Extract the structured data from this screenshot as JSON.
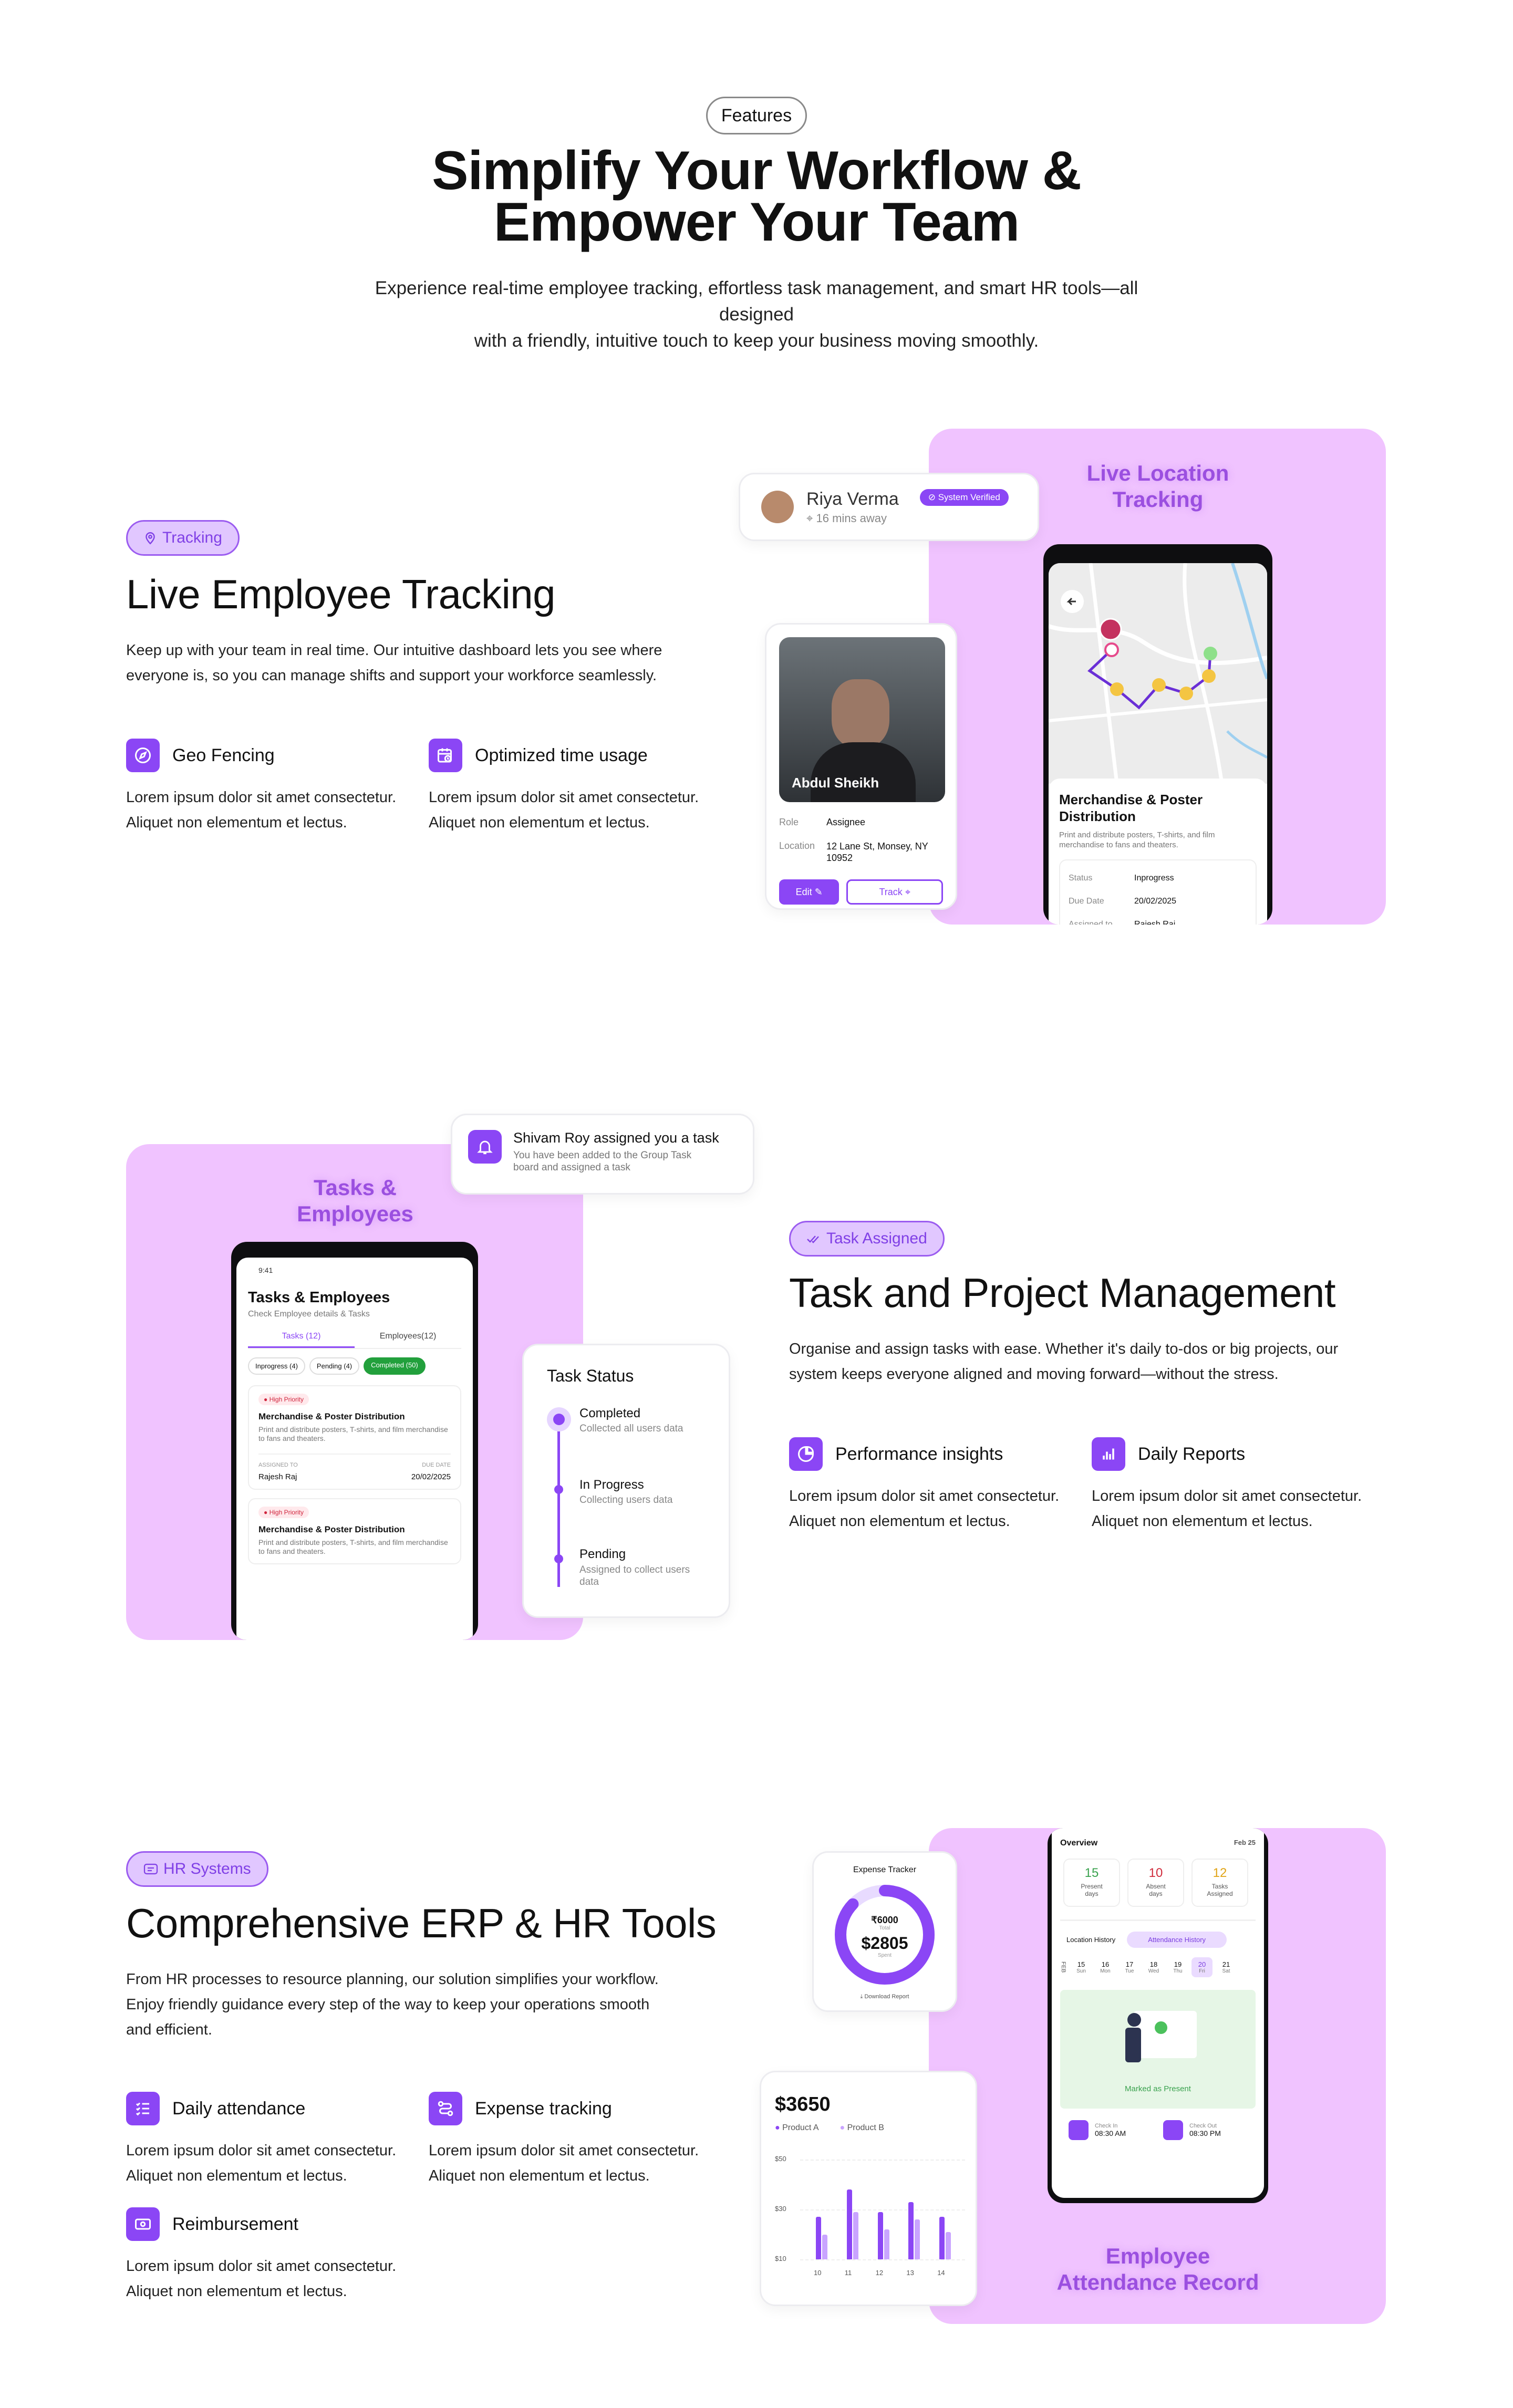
{
  "header": {
    "pill": "Features",
    "title_line1": "Simplify Your Workflow &",
    "title_line2": "Empower Your Team",
    "subtitle_line1": "Experience real-time employee tracking, effortless task management, and smart HR tools—all designed",
    "subtitle_line2": "with a friendly, intuitive touch to keep your business moving smoothly."
  },
  "tracking": {
    "tag": "Tracking",
    "title": "Live Employee Tracking",
    "desc_line1": "Keep up with your team in real time. Our intuitive dashboard lets you see where",
    "desc_line2": "everyone is, so you can manage shifts and support your workforce seamlessly.",
    "features": [
      {
        "title": "Geo Fencing",
        "line1": "Lorem ipsum dolor sit amet consectetur.",
        "line2": "Aliquet non elementum et lectus."
      },
      {
        "title": "Optimized time usage",
        "line1": "Lorem ipsum dolor sit amet consectetur.",
        "line2": "Aliquet non elementum et lectus."
      }
    ],
    "visual": {
      "label_line1": "Live Location",
      "label_line2": "Tracking",
      "user_name": "Riya Verma",
      "user_distance": "16 mins away",
      "verified": "System Verified",
      "profile_name": "Abdul Sheikh",
      "role_label": "Role",
      "role_value": "Assignee",
      "location_label": "Location",
      "location_value": "12 Lane St, Monsey, NY 10952",
      "edit": "Edit",
      "track": "Track",
      "task_title": "Merchandise & Poster Distribution",
      "task_desc": "Print and distribute posters, T-shirts, and film merchandise to fans and theaters.",
      "status_label": "Status",
      "status_value": "Inprogress",
      "due_label": "Due Date",
      "due_value": "20/02/2025",
      "assigned_label": "Assigned to",
      "assigned_value": "Rajesh Raj"
    }
  },
  "tasks": {
    "tag": "Task Assigned",
    "title": "Task and Project Management",
    "desc_line1": "Organise and assign tasks with ease. Whether it's daily to-dos or big projects, our",
    "desc_line2": "system keeps everyone aligned and moving forward—without the stress.",
    "features": [
      {
        "title": "Performance insights",
        "line1": "Lorem ipsum dolor sit amet consectetur.",
        "line2": "Aliquet non elementum et lectus."
      },
      {
        "title": "Daily Reports",
        "line1": "Lorem ipsum dolor sit amet consectetur.",
        "line2": "Aliquet non elementum et lectus."
      }
    ],
    "visual": {
      "label_line1": "Tasks &",
      "label_line2": "Employees",
      "notif_title": "Shivam Roy assigned you a task",
      "notif_line1": "You have been added to the Group Task",
      "notif_line2": "board and assigned a task",
      "screen_title": "Tasks & Employees",
      "screen_sub": "Check Employee details & Tasks",
      "tab_tasks": "Tasks (12)",
      "tab_employees": "Employees(12)",
      "chip_inprogress": "Inprogress (4)",
      "chip_pending": "Pending (4)",
      "chip_completed": "Completed (50)",
      "priority": "High Priority",
      "card_title": "Merchandise & Poster Distribution",
      "card_desc": "Print and distribute posters, T-shirts, and film merchandise to fans and theaters.",
      "assigned_to": "ASSIGNED TO",
      "due_date": "DUE DATE",
      "assignee": "Rajesh Raj",
      "due": "20/02/2025",
      "status_title": "Task Status",
      "steps": [
        {
          "title": "Completed",
          "desc": "Collected all users data"
        },
        {
          "title": "In Progress",
          "desc": "Collecting users data"
        },
        {
          "title": "Pending",
          "desc": "Assigned to collect users data"
        }
      ]
    }
  },
  "hr": {
    "tag": "HR Systems",
    "title": "Comprehensive ERP & HR Tools",
    "desc_line1": "From HR processes to resource planning, our solution simplifies your workflow.",
    "desc_line2": "Enjoy friendly guidance every step of the way to keep your operations smooth",
    "desc_line3": "and efficient.",
    "features": [
      {
        "title": "Daily attendance",
        "line1": "Lorem ipsum dolor sit amet consectetur.",
        "line2": "Aliquet non elementum et lectus."
      },
      {
        "title": "Expense tracking",
        "line1": "Lorem ipsum dolor sit amet consectetur.",
        "line2": "Aliquet non elementum et lectus."
      },
      {
        "title": "Reimbursement",
        "line1": "Lorem ipsum dolor sit amet consectetur.",
        "line2": "Aliquet non elementum et lectus."
      }
    ],
    "visual": {
      "label_line1": "Employee",
      "label_line2": "Attendance Record",
      "expense_title": "Expense Tracker",
      "expense_total": "6000",
      "expense_total_label": "Total",
      "expense_spent": "2805",
      "expense_spent_label": "Spent",
      "download": "Download Report",
      "chart_value": "$3650",
      "overview": "Overview",
      "overview_date": "Feb 25",
      "present_num": "15",
      "present_label": "Present days",
      "absent_num": "10",
      "absent_label": "Absent days",
      "tasks_num": "12",
      "tasks_label": "Tasks Assigned",
      "tab_location": "Location History",
      "tab_attendance": "Attendance History",
      "month": "FEB",
      "days": [
        {
          "num": "15",
          "name": "Sun"
        },
        {
          "num": "16",
          "name": "Mon"
        },
        {
          "num": "17",
          "name": "Tue"
        },
        {
          "num": "18",
          "name": "Wed"
        },
        {
          "num": "19",
          "name": "Thu"
        },
        {
          "num": "20",
          "name": "Fri"
        },
        {
          "num": "21",
          "name": "Sat"
        }
      ],
      "marked": "Marked as Present",
      "checkin_label": "Check In",
      "checkin_time": "08:30 AM",
      "checkout_label": "Check Out",
      "checkout_time": "08:30 PM"
    }
  },
  "chart_data": {
    "type": "bar",
    "title": "$3650",
    "categories": [
      "10",
      "11",
      "12",
      "13",
      "14"
    ],
    "series": [
      {
        "name": "Product A",
        "values": [
          27,
          38,
          29,
          33,
          27
        ]
      },
      {
        "name": "Product B",
        "values": [
          20,
          29,
          22,
          26,
          21
        ]
      }
    ],
    "ylim": [
      10,
      50
    ],
    "yticks": [
      "$50",
      "$30",
      "$10"
    ],
    "colors": {
      "Product A": "#8b46f5",
      "Product B": "#c9a4ff"
    }
  }
}
